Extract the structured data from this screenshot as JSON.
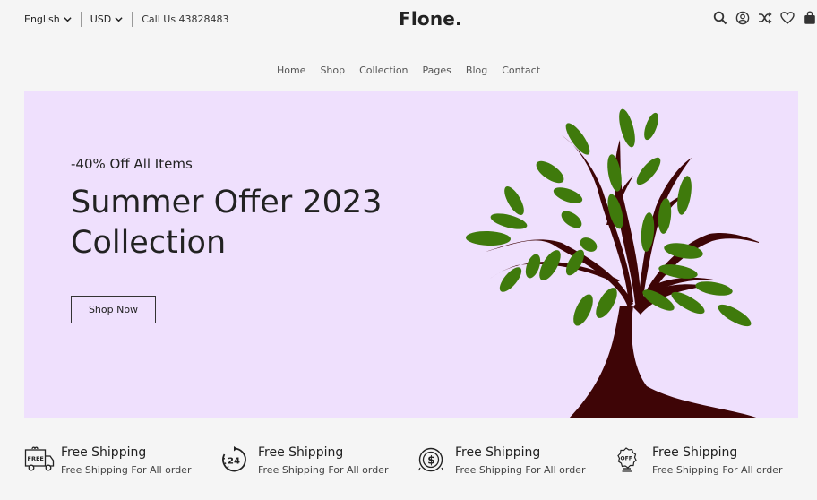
{
  "header": {
    "language": "English",
    "currency": "USD",
    "call": "Call Us 43828483",
    "logo": "Flone.",
    "icons": [
      "search-icon",
      "user-icon",
      "shuffle-icon",
      "heart-icon",
      "bag-icon"
    ]
  },
  "nav": {
    "items": [
      {
        "label": "Home"
      },
      {
        "label": "Shop"
      },
      {
        "label": "Collection"
      },
      {
        "label": "Pages"
      },
      {
        "label": "Blog"
      },
      {
        "label": "Contact"
      }
    ]
  },
  "hero": {
    "subtitle": "-40% Off All Items",
    "title_line1": "Summer Offer 2023",
    "title_line2": "Collection",
    "button": "Shop Now",
    "background": "#efe0fd",
    "tree_trunk_color": "#3e0506",
    "leaf_color": "#3f7a0c"
  },
  "features": [
    {
      "icon": "free-delivery-truck-icon",
      "title": "Free Shipping",
      "subtitle": "Free Shipping For All order"
    },
    {
      "icon": "24-hours-icon",
      "title": "Free Shipping",
      "subtitle": "Free Shipping For All order"
    },
    {
      "icon": "dollar-coin-icon",
      "title": "Free Shipping",
      "subtitle": "Free Shipping For All order"
    },
    {
      "icon": "discount-badge-icon",
      "title": "Free Shipping",
      "subtitle": "Free Shipping For All order"
    }
  ]
}
